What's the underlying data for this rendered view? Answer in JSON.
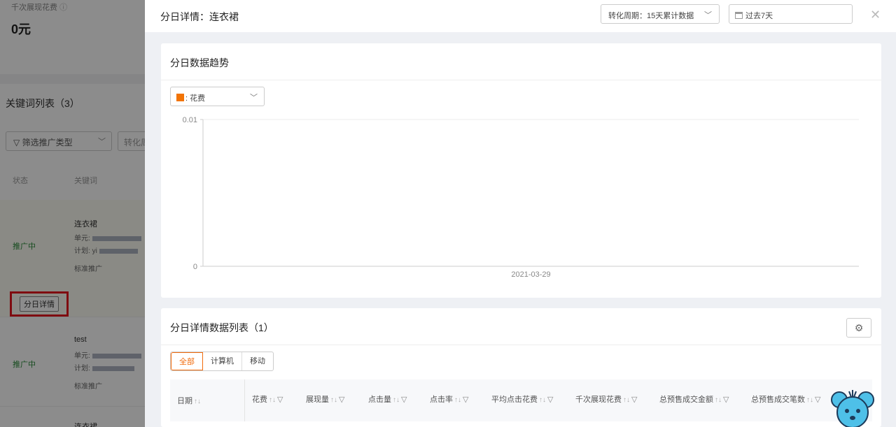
{
  "background": {
    "metric_label": "千次展现花费",
    "metric_value": "0元",
    "list_title": "关键词列表（3）",
    "filter_type": "筛选推广类型",
    "filter_period_partial": "转化周",
    "columns": {
      "status": "状态",
      "keyword": "关键词"
    },
    "rows": [
      {
        "status": "推广中",
        "keyword": "连衣裙",
        "unit_label": "单元:",
        "plan_label": "计划:",
        "plan_value": "yi",
        "type": "标准推广",
        "detail_button": "分日详情"
      },
      {
        "status": "推广中",
        "keyword": "test",
        "unit_label": "单元:",
        "plan_label": "计划:",
        "type": "标准推广"
      },
      {
        "keyword": "连衣裙"
      }
    ]
  },
  "drawer": {
    "title": "分日详情：连衣裙",
    "period_select": "转化周期：15天累计数据",
    "date_range": "过去7天",
    "close_icon": "close-icon"
  },
  "trend": {
    "title": "分日数据趋势",
    "metric_select": {
      "label": "花费",
      "prefix": ":",
      "color": "#f27405"
    }
  },
  "chart_data": {
    "type": "line",
    "x": [
      "2021-03-29"
    ],
    "series": [
      {
        "name": "花费",
        "values": [
          0
        ]
      }
    ],
    "xlabel": "",
    "ylabel": "",
    "ylim": [
      0,
      0.01
    ],
    "yticks": [
      "0",
      "0.01"
    ],
    "grid": true
  },
  "table": {
    "title": "分日详情数据列表（1）",
    "tabs": [
      "全部",
      "计算机",
      "移动"
    ],
    "active_tab": 0,
    "columns": [
      "日期",
      "花费",
      "展现量",
      "点击量",
      "点击率",
      "平均点击花费",
      "千次展现花费",
      "总预售成交金额",
      "总预售成交笔数"
    ]
  }
}
